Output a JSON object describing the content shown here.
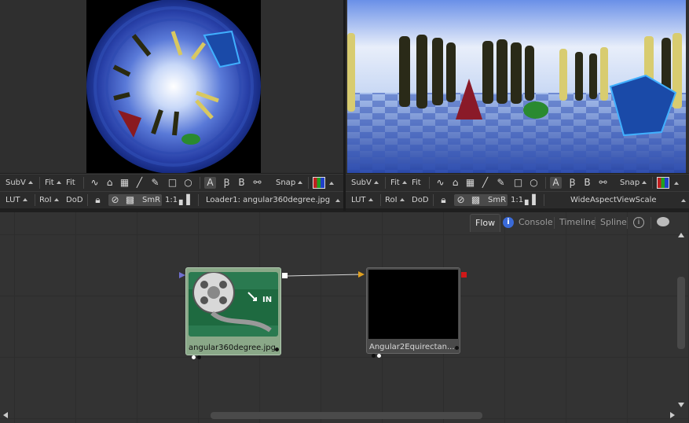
{
  "viewer_left": {
    "toolbar_row1": {
      "subv": "SubV",
      "fit_a": "Fit",
      "fit_b": "Fit",
      "font_a": "A",
      "font_b": "B",
      "snap": "Snap"
    },
    "toolbar_row2": {
      "lut": "LUT",
      "roi": "RoI",
      "dod": "DoD",
      "smr": "SmR",
      "ratio": "1:1",
      "source": "Loader1: angular360degree.jpg"
    }
  },
  "viewer_right": {
    "toolbar_row1": {
      "subv": "SubV",
      "fit_a": "Fit",
      "fit_b": "Fit",
      "font_a": "A",
      "font_b": "B",
      "snap": "Snap"
    },
    "toolbar_row2": {
      "lut": "LUT",
      "roi": "RoI",
      "dod": "DoD",
      "smr": "SmR",
      "ratio": "1:1",
      "source": "WideAspectViewScale"
    }
  },
  "tabs": {
    "flow": "Flow",
    "console": "Console",
    "timeline": "Timeline",
    "spline": "Spline"
  },
  "nodes": {
    "loader": {
      "label": "angular360degree.jpg",
      "badge": "IN",
      "color": "#8aa888"
    },
    "angular": {
      "label": "Angular2Equirectan..."
    }
  },
  "colors": {
    "accent_active": "#e6e6e6",
    "output_port": "#d01818",
    "input_port": "#e0a020",
    "viewer_bg": "#2f2f2f"
  }
}
